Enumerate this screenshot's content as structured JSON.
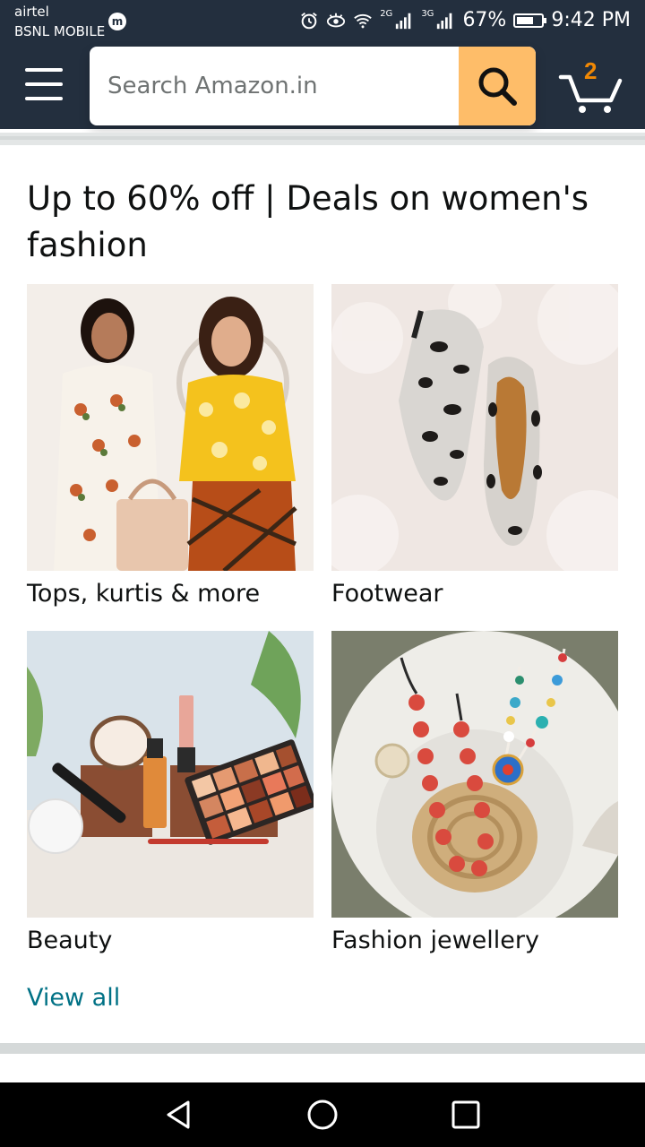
{
  "status_bar": {
    "carrier_line1": "airtel",
    "carrier_line2": "BSNL MOBILE",
    "carrier_badge": "m",
    "network_1": "2G",
    "network_2": "3G",
    "battery_percent": "67%",
    "time": "9:42 PM"
  },
  "header": {
    "search_placeholder": "Search Amazon.in",
    "cart_count": "2",
    "colors": {
      "bar": "#232f3e",
      "search_button": "#febd69",
      "cart_count": "#f08804"
    }
  },
  "card": {
    "title": "Up to 60% off | Deals on women's fashion",
    "tiles": [
      {
        "label": "Tops, kurtis & more",
        "image": "women-fashion-models"
      },
      {
        "label": "Footwear",
        "image": "snakeskin-heels"
      },
      {
        "label": "Beauty",
        "image": "makeup-products"
      },
      {
        "label": "Fashion jewellery",
        "image": "beaded-necklaces"
      }
    ],
    "view_all": "View all",
    "link_color": "#007185"
  },
  "nav_bar": {
    "icons": [
      "back-icon",
      "home-icon",
      "recents-icon"
    ]
  }
}
